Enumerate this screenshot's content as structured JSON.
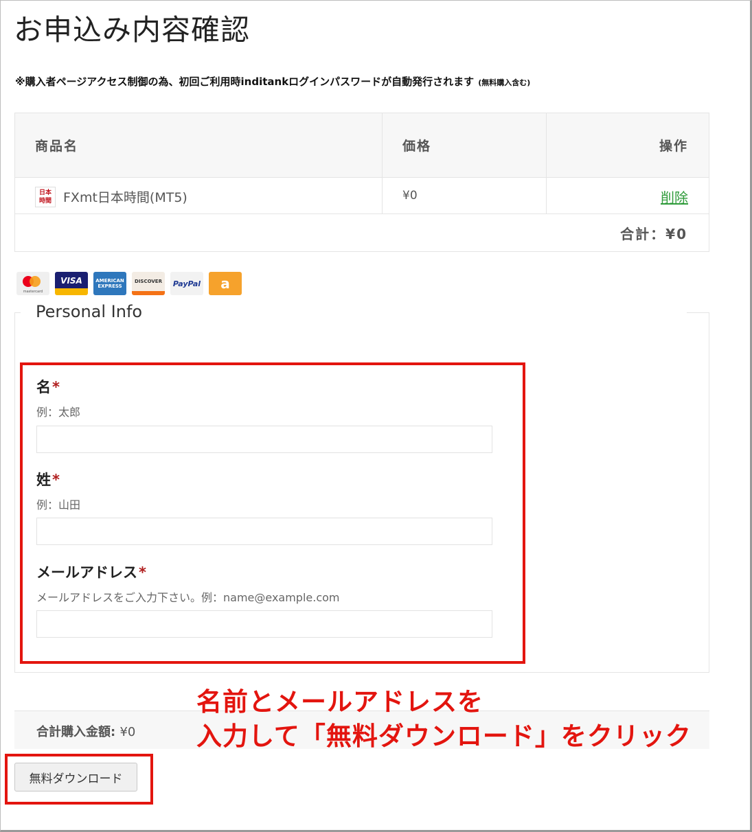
{
  "page": {
    "title": "お申込み内容確認",
    "notice": "※購入者ページアクセス制御の為、初回ご利用時inditankログインパスワードが自動発行されます",
    "notice_small": "(無料購入含む)"
  },
  "cart": {
    "headers": {
      "name": "商品名",
      "price": "価格",
      "action": "操作"
    },
    "item": {
      "icon_text": "日本\n時間",
      "name": "FXmt日本時間(MT5)",
      "price": "¥0",
      "delete_label": "削除"
    },
    "total": "合計：¥0"
  },
  "payment_methods": [
    {
      "name": "mastercard",
      "label": "mastercard"
    },
    {
      "name": "visa",
      "label": "VISA"
    },
    {
      "name": "american-express",
      "label": "AMERICAN EXPRESS"
    },
    {
      "name": "discover",
      "label": "DISCOVER"
    },
    {
      "name": "paypal",
      "label": "PayPal"
    },
    {
      "name": "amazon-pay",
      "label": "a"
    }
  ],
  "personal_info": {
    "legend": "Personal Info",
    "first_name": {
      "label": "名",
      "required": "*",
      "help": "例：太郎",
      "value": ""
    },
    "last_name": {
      "label": "姓",
      "required": "*",
      "help": "例：山田",
      "value": ""
    },
    "email": {
      "label": "メールアドレス",
      "required": "*",
      "help": "メールアドレスをご入力下さい。例：name@example.com",
      "value": ""
    }
  },
  "summary": {
    "label": "合計購入金額:",
    "value": "¥0"
  },
  "download_button": "無料ダウンロード",
  "annotation": {
    "line1": "名前とメールアドレスを",
    "line2": "入力して「無料ダウンロード」をクリック"
  },
  "colors": {
    "highlight": "#e3150f",
    "delete_link": "#2e9b3a",
    "required": "#b01e1e"
  }
}
